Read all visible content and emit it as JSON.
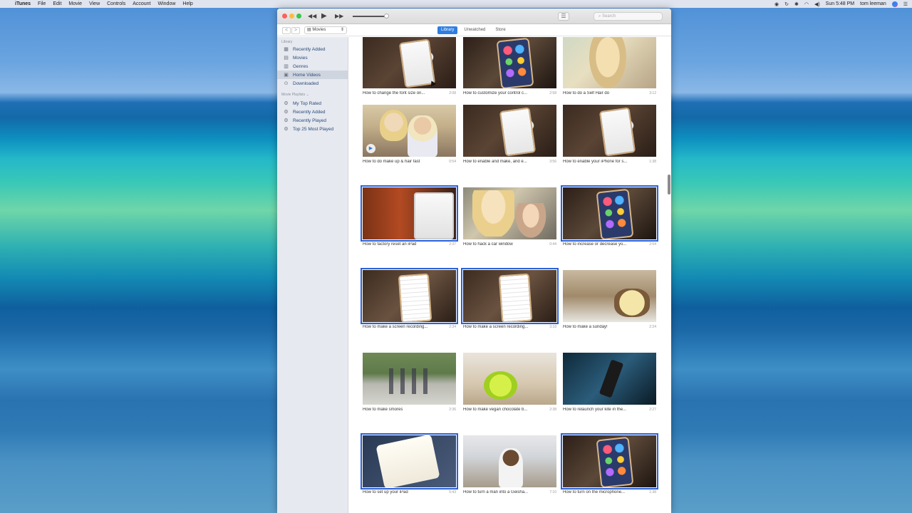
{
  "menubar": {
    "apple": "",
    "items": [
      "iTunes",
      "File",
      "Edit",
      "Movie",
      "View",
      "Controls",
      "Account",
      "Window",
      "Help"
    ],
    "clock": "Sun 5:48 PM",
    "user": "tom leeman"
  },
  "titlebar": {
    "prev_label": "◀◀",
    "play_label": "▶",
    "next_label": "▶▶",
    "logo": "",
    "list_toggle": "☰",
    "search_placeholder": "Search"
  },
  "toolbar": {
    "back": "<",
    "forward": ">",
    "media_kind": "Movies",
    "tabs": [
      {
        "label": "Library",
        "active": true
      },
      {
        "label": "Unwatched",
        "active": false
      },
      {
        "label": "Store",
        "active": false
      }
    ]
  },
  "sidebar": {
    "library_header": "Library",
    "library_items": [
      {
        "label": "Recently Added",
        "icon": "grid-icon"
      },
      {
        "label": "Movies",
        "icon": "film-icon"
      },
      {
        "label": "Genres",
        "icon": "genres-icon"
      },
      {
        "label": "Home Videos",
        "icon": "home-video-icon",
        "selected": true
      },
      {
        "label": "Downloaded",
        "icon": "download-icon"
      }
    ],
    "playlists_header": "Movie Playlists ⌄",
    "playlist_items": [
      {
        "label": "My Top Rated",
        "icon": "gear-icon"
      },
      {
        "label": "Recently Added",
        "icon": "gear-icon"
      },
      {
        "label": "Recently Played",
        "icon": "gear-icon"
      },
      {
        "label": "Top 25 Most Played",
        "icon": "gear-icon"
      }
    ]
  },
  "videos": [
    {
      "title": "How to change the font size on...",
      "duration": "2:08",
      "thumb": "phone",
      "selected": false
    },
    {
      "title": "How to customize your control c...",
      "duration": "2:58",
      "thumb": "colorphone",
      "selected": false
    },
    {
      "title": "How to do a Self Hair do",
      "duration": "3:12",
      "thumb": "hair",
      "selected": false
    },
    {
      "title": "How to do make up & hair fast",
      "duration": "0:54",
      "thumb": "people",
      "selected": false,
      "play_badge": true
    },
    {
      "title": "How to enable and make, and e...",
      "duration": "3:56",
      "thumb": "phone",
      "selected": false
    },
    {
      "title": "How to enable your iPhone for s...",
      "duration": "1:38",
      "thumb": "phone",
      "selected": false
    },
    {
      "title": "How to factory reset an iPad",
      "duration": "2:37",
      "thumb": "ipadorange",
      "selected": true
    },
    {
      "title": "How to hack a car window",
      "duration": "0:44",
      "thumb": "carwin",
      "selected": false
    },
    {
      "title": "How to increase or decrease yo...",
      "duration": "2:54",
      "thumb": "colorphone",
      "selected": true
    },
    {
      "title": "How to make a screen recording...",
      "duration": "2:34",
      "thumb": "settings",
      "selected": true
    },
    {
      "title": "How to make a screen recording...",
      "duration": "3:18",
      "thumb": "settings",
      "selected": true
    },
    {
      "title": "How to make a sunday!",
      "duration": "2:24",
      "thumb": "sundae",
      "selected": false
    },
    {
      "title": "How to make smores",
      "duration": "2:36",
      "thumb": "yard",
      "selected": false
    },
    {
      "title": "How to make vegan chocolate b...",
      "duration": "2:38",
      "thumb": "kitchen",
      "selected": false
    },
    {
      "title": "How to relaunch your kite in the...",
      "duration": "2:27",
      "thumb": "kite",
      "selected": false
    },
    {
      "title": "How to set up your iPad",
      "duration": "5:43",
      "thumb": "ipadwhite",
      "selected": true
    },
    {
      "title": "How to turn a man into a Geisha...",
      "duration": "7:10",
      "thumb": "room",
      "selected": false
    },
    {
      "title": "How to turn on the microphone...",
      "duration": "1:38",
      "thumb": "colorphone",
      "selected": true
    }
  ]
}
